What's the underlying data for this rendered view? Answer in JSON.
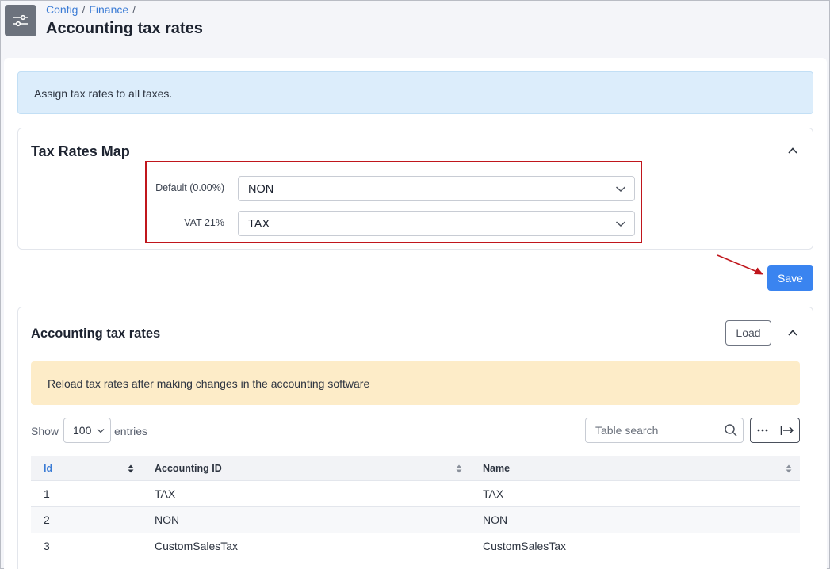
{
  "breadcrumb": {
    "items": [
      "Config",
      "Finance"
    ],
    "separator": "/"
  },
  "page_title": "Accounting tax rates",
  "info_alert": "Assign tax rates to all taxes.",
  "tax_rates_map": {
    "title": "Tax Rates Map",
    "rows": [
      {
        "label": "Default (0.00%)",
        "value": "NON"
      },
      {
        "label": "VAT 21%",
        "value": "TAX"
      }
    ]
  },
  "save_label": "Save",
  "accounting_tax_rates": {
    "title": "Accounting tax rates",
    "load_label": "Load",
    "warning": "Reload tax rates after making changes in the accounting software",
    "show_label": "Show",
    "entries_value": "100",
    "entries_label": "entries",
    "search_placeholder": "Table search",
    "columns": [
      "Id",
      "Accounting ID",
      "Name"
    ],
    "rows": [
      [
        "1",
        "TAX",
        "TAX"
      ],
      [
        "2",
        "NON",
        "NON"
      ],
      [
        "3",
        "CustomSalesTax",
        "CustomSalesTax"
      ]
    ]
  },
  "colors": {
    "accent": "#3a84f0",
    "highlight_border": "#c0161c",
    "info_bg": "#dcedfb",
    "warning_bg": "#fdecc8"
  }
}
